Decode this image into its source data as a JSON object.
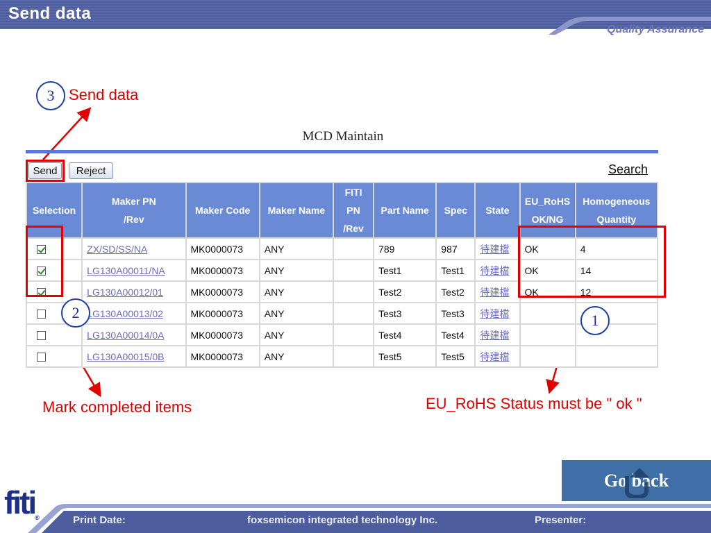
{
  "header": {
    "title": "Send data",
    "subtitle": "Quality Assurance"
  },
  "annotations": {
    "step3": {
      "number": "3",
      "text": "Send data"
    },
    "step2": {
      "number": "2",
      "text": "Mark completed items"
    },
    "step1": {
      "number": "1",
      "text": "EU_RoHS Status must be \" ok \""
    }
  },
  "form": {
    "title": "MCD Maintain",
    "send_label": "Send",
    "reject_label": "Reject",
    "search_label": "Search",
    "columns": [
      {
        "l1": "Selection",
        "l2": ""
      },
      {
        "l1": "Maker PN",
        "l2": "/Rev"
      },
      {
        "l1": "Maker Code",
        "l2": ""
      },
      {
        "l1": "Maker Name",
        "l2": ""
      },
      {
        "l1": "FITI PN",
        "l2": "/Rev"
      },
      {
        "l1": "Part Name",
        "l2": ""
      },
      {
        "l1": "Spec",
        "l2": ""
      },
      {
        "l1": "State",
        "l2": ""
      },
      {
        "l1": "EU_RoHS",
        "l2": "OK/NG"
      },
      {
        "l1": "Homogeneous",
        "l2": "Quantity"
      }
    ],
    "rows": [
      {
        "checked": true,
        "maker_pn": "ZX/SD/SS/NA",
        "maker_code": "MK0000073",
        "maker_name": "ANY",
        "fiti_pn": "",
        "part_name": "789",
        "spec": "987",
        "state": "待建檔",
        "eu_rohs": "OK",
        "quantity": "4"
      },
      {
        "checked": true,
        "maker_pn": "LG130A00011/NA",
        "maker_code": "MK0000073",
        "maker_name": "ANY",
        "fiti_pn": "",
        "part_name": "Test1",
        "spec": "Test1",
        "state": "待建檔",
        "eu_rohs": "OK",
        "quantity": "14"
      },
      {
        "checked": true,
        "maker_pn": "LG130A00012/01",
        "maker_code": "MK0000073",
        "maker_name": "ANY",
        "fiti_pn": "",
        "part_name": "Test2",
        "spec": "Test2",
        "state": "待建檔",
        "eu_rohs": "OK",
        "quantity": "12"
      },
      {
        "checked": false,
        "maker_pn": "LG130A00013/02",
        "maker_code": "MK0000073",
        "maker_name": "ANY",
        "fiti_pn": "",
        "part_name": "Test3",
        "spec": "Test3",
        "state": "待建檔",
        "eu_rohs": "",
        "quantity": ""
      },
      {
        "checked": false,
        "maker_pn": "LG130A00014/0A",
        "maker_code": "MK0000073",
        "maker_name": "ANY",
        "fiti_pn": "",
        "part_name": "Test4",
        "spec": "Test4",
        "state": "待建檔",
        "eu_rohs": "",
        "quantity": ""
      },
      {
        "checked": false,
        "maker_pn": "LG130A00015/0B",
        "maker_code": "MK0000073",
        "maker_name": "ANY",
        "fiti_pn": "",
        "part_name": "Test5",
        "spec": "Test5",
        "state": "待建檔",
        "eu_rohs": "",
        "quantity": ""
      }
    ]
  },
  "go_back_label": "Go back",
  "logo_text": "fiti",
  "footer": {
    "print_date": "Print Date:",
    "company": "foxsemicon integrated technology Inc.",
    "presenter": "Presenter:"
  },
  "colors": {
    "header": "#4c5c9c",
    "table_header": "#6a8ad6",
    "annotation": "#e00000",
    "go_back": "#3f6fa6"
  }
}
